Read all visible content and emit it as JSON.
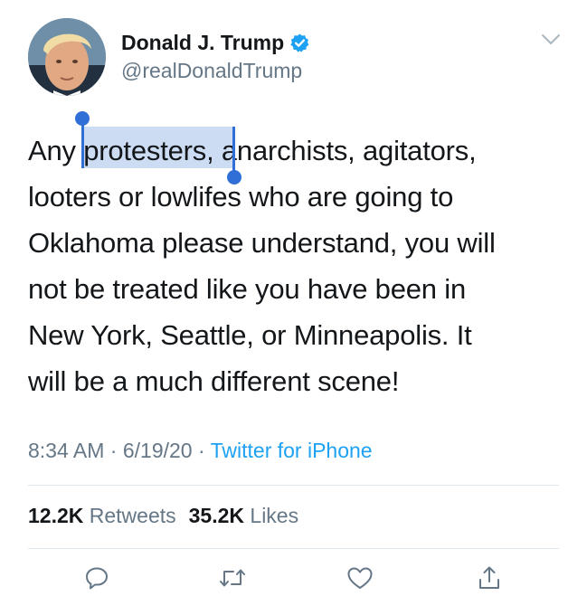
{
  "user": {
    "display_name": "Donald J. Trump",
    "handle": "@realDonaldTrump",
    "verified": true
  },
  "tweet": {
    "text": "Any protesters, anarchists, agitators,\nlooters or lowlifes who are going to\nOklahoma please understand, you will\nnot be treated like you have been in\nNew York, Seattle, or Minneapolis. It\nwill be a much different scene!",
    "selected_text": "protesters,"
  },
  "meta": {
    "time": "8:34 AM",
    "separator": " · ",
    "date": "6/19/20",
    "source": "Twitter for iPhone"
  },
  "stats": {
    "retweets_count": "12.2K",
    "retweets_label": "Retweets",
    "likes_count": "35.2K",
    "likes_label": "Likes"
  },
  "actions": [
    "reply-icon",
    "retweet-icon",
    "like-icon",
    "share-icon"
  ],
  "colors": {
    "accent": "#1da1f2",
    "selection": "#2f6fd6",
    "secondary_text": "#657786",
    "divider": "#e1e8ed"
  }
}
